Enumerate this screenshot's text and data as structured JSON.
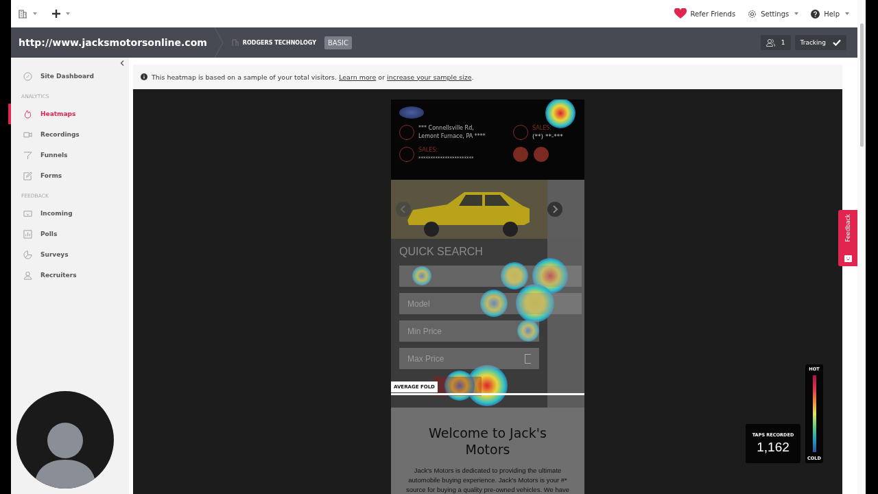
{
  "top_bar": {
    "links": [
      {
        "label": "Refer Friends",
        "kind": "refer"
      },
      {
        "label": "Settings",
        "kind": "settings"
      },
      {
        "label": "Help",
        "kind": "help"
      }
    ]
  },
  "site_bar": {
    "url": "http://www.jacksmotorsonline.com",
    "account": "RODGERS TECHNOLOGY",
    "plan": "BASIC",
    "users": "1",
    "tracking": "Tracking"
  },
  "sidebar": {
    "items": [
      {
        "kind": "link",
        "label": "Site Dashboard",
        "selected": false
      },
      {
        "kind": "header",
        "label": "ANALYTICS"
      },
      {
        "kind": "link",
        "label": "Heatmaps",
        "selected": true
      },
      {
        "kind": "link",
        "label": "Recordings",
        "selected": false
      },
      {
        "kind": "link",
        "label": "Funnels",
        "selected": false
      },
      {
        "kind": "link",
        "label": "Forms",
        "selected": false
      },
      {
        "kind": "header",
        "label": "FEEDBACK"
      },
      {
        "kind": "link",
        "label": "Incoming",
        "selected": false
      },
      {
        "kind": "link",
        "label": "Polls",
        "selected": false
      },
      {
        "kind": "link",
        "label": "Surveys",
        "selected": false
      },
      {
        "kind": "link",
        "label": "Recruiters",
        "selected": false
      }
    ]
  },
  "notice": {
    "text": "This heatmap is based on a sample of your total visitors.",
    "link_1": "Learn more",
    "joiner": "or",
    "link_2": "increase your sample size",
    "end": "."
  },
  "preview": {
    "address": [
      "*** Connellsville Rd,",
      "Lemont Furnace, PA ****"
    ],
    "sales_label_1": "SALES:",
    "sales_phone": "(**) **-***",
    "sales_label_2": "SALES:",
    "sales_email": "***********************",
    "quick_search": "QUICK SEARCH",
    "fields": [
      {
        "kind": "select"
      },
      {
        "placeholder": "Model",
        "kind": "select"
      },
      {
        "placeholder": "Min Price",
        "kind": "number"
      },
      {
        "placeholder": "Max Price",
        "kind": "number"
      }
    ],
    "fold_label": "AVERAGE FOLD",
    "welcome_title": "Welcome to Jack's Motors",
    "welcome_text": "Jack's Motors is dedicated to providing the ultimate automobile buying experience. Jack's Motors is your #* source for buying a quality pre-owned vehicles. We have"
  },
  "legend": {
    "hot": "HOT",
    "cold": "COLD",
    "taps_label": "TAPS RECORDED",
    "taps": "1,162"
  },
  "feedback_tab": "Feedback"
}
